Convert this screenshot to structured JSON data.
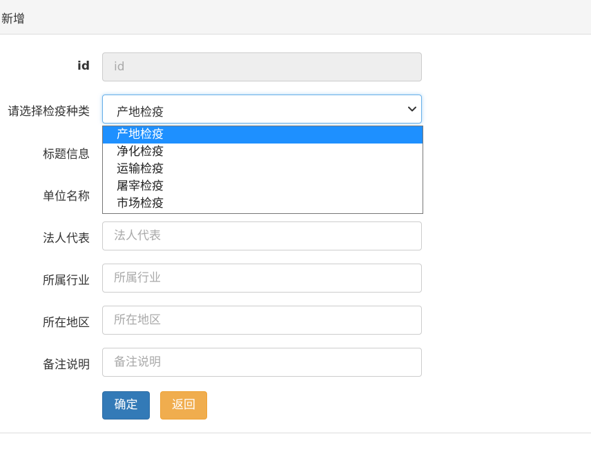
{
  "header": {
    "title": "新增"
  },
  "form": {
    "id": {
      "label": "id",
      "placeholder": "id",
      "value": ""
    },
    "category": {
      "label": "请选择检疫种类",
      "selected": "产地检疫",
      "options": [
        "产地检疫",
        "净化检疫",
        "运输检疫",
        "屠宰检疫",
        "市场检疫"
      ]
    },
    "title": {
      "label": "标题信息"
    },
    "unit": {
      "label": "单位名称"
    },
    "legal_rep": {
      "label": "法人代表",
      "placeholder": "法人代表"
    },
    "industry": {
      "label": "所属行业",
      "placeholder": "所属行业"
    },
    "region": {
      "label": "所在地区",
      "placeholder": "所在地区"
    },
    "remark": {
      "label": "备注说明",
      "placeholder": "备注说明"
    }
  },
  "actions": {
    "confirm_label": "确定",
    "back_label": "返回"
  },
  "icons": {
    "select_arrow": "chevron-down-icon"
  },
  "colors": {
    "primary": "#337ab7",
    "warning": "#f0ad4e",
    "selected_option": "#1e90ff",
    "focus_border": "#66afe9"
  }
}
